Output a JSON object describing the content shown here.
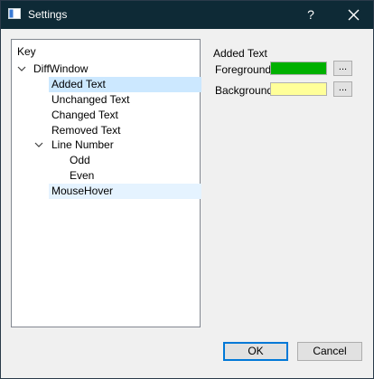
{
  "window": {
    "title": "Settings",
    "help": "?"
  },
  "tree": {
    "header": "Key",
    "root": "DiffWindow",
    "items": [
      {
        "label": "Added Text"
      },
      {
        "label": "Unchanged Text"
      },
      {
        "label": "Changed Text"
      },
      {
        "label": "Removed Text"
      },
      {
        "label": "Line Number"
      },
      {
        "label": "Odd"
      },
      {
        "label": "Even"
      },
      {
        "label": "MouseHover"
      }
    ]
  },
  "detail": {
    "title": "Added Text",
    "foreground_label": "Foreground",
    "background_label": "Background",
    "foreground_color": "#00b000",
    "background_color": "#ffff99",
    "browse_label": "..."
  },
  "buttons": {
    "ok": "OK",
    "cancel": "Cancel"
  },
  "colors": {
    "titlebar": "#0e2a36",
    "selection": "#cce8ff",
    "hover": "#e5f3ff",
    "default_button_border": "#0078d7"
  }
}
